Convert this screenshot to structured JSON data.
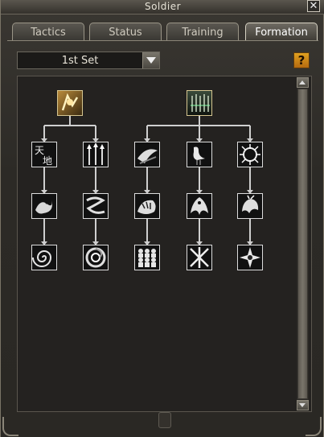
{
  "window": {
    "title": "Soldier",
    "close_icon": "close-icon"
  },
  "tabs": [
    {
      "label": "Tactics",
      "active": false
    },
    {
      "label": "Status",
      "active": false
    },
    {
      "label": "Training",
      "active": false
    },
    {
      "label": "Formation",
      "active": true
    }
  ],
  "formation_set": {
    "selected": "1st Set"
  },
  "help": {
    "label": "?"
  },
  "colors": {
    "accent": "#e0a020",
    "panel": "#242220",
    "line": "#cfcfcf"
  },
  "tree": {
    "roots": [
      {
        "icon": "warrior-formation-icon"
      },
      {
        "icon": "spear-formation-icon"
      }
    ],
    "tier2": [
      {
        "icon": "heaven-earth-icon"
      },
      {
        "icon": "spear-row-icon"
      },
      {
        "icon": "mantis-icon"
      },
      {
        "icon": "crane-icon"
      },
      {
        "icon": "burst-icon"
      }
    ],
    "tier3": [
      {
        "icon": "dragon-icon"
      },
      {
        "icon": "serpent-icon"
      },
      {
        "icon": "tiger-icon"
      },
      {
        "icon": "phoenix-icon"
      },
      {
        "icon": "qilin-icon"
      }
    ],
    "tier4": [
      {
        "icon": "coil-icon"
      },
      {
        "icon": "vortex-icon"
      },
      {
        "icon": "twin-troops-icon"
      },
      {
        "icon": "crossed-blades-icon"
      },
      {
        "icon": "star-compass-icon"
      }
    ]
  }
}
